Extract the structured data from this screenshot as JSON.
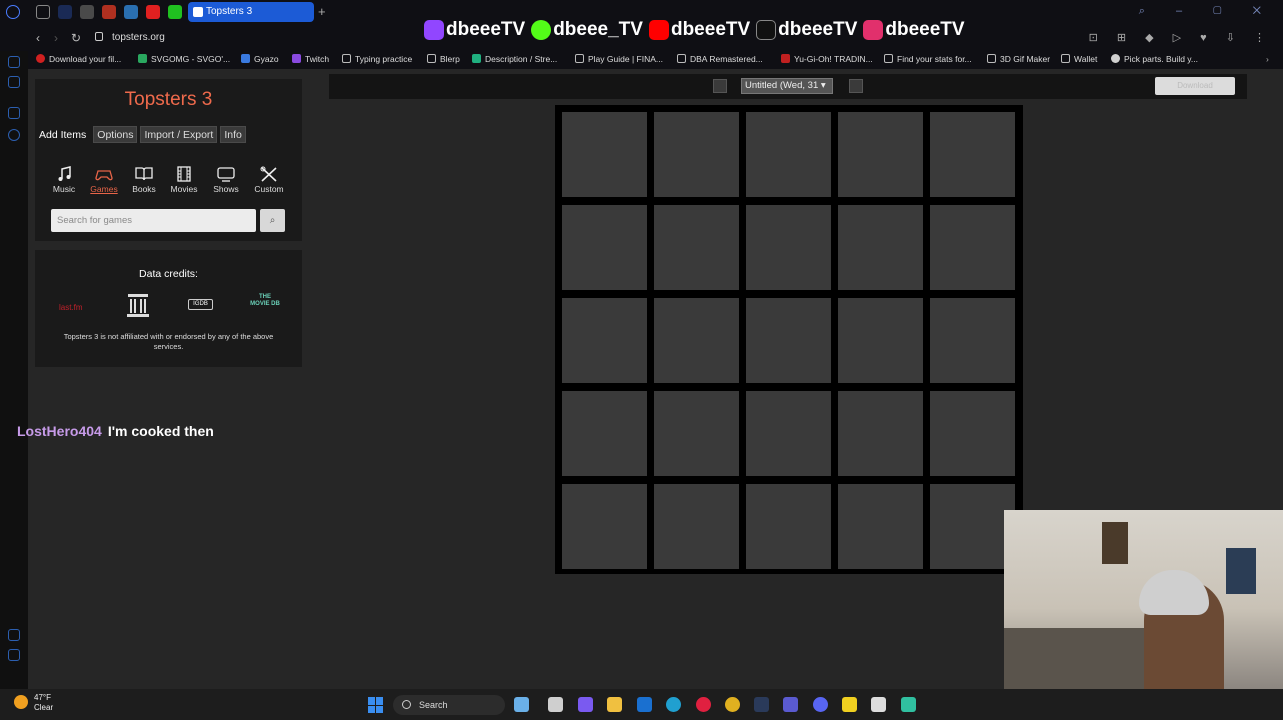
{
  "browser": {
    "active_tab_title": "Topsters 3",
    "url": "topsters.org",
    "bookmarks": [
      "Download your fil...",
      "SVGOMG - SVGO'...",
      "Gyazo",
      "Twitch",
      "Typing practice",
      "Blerp",
      "Description / Stre...",
      "Play Guide | FINA...",
      "DBA Remastered...",
      "Yu-Gi-Oh! TRADIN...",
      "Find your stats for...",
      "3D Gif Maker",
      "Wallet",
      "Pick parts. Build y..."
    ]
  },
  "overlay": {
    "socials": [
      "dbeeeTV",
      "dbeee_TV",
      "dbeeeTV",
      "dbeeeTV",
      "dbeeeTV"
    ],
    "chat_user": "LostHero404",
    "chat_message": "I'm cooked then"
  },
  "topsters": {
    "title": "Topsters 3",
    "tabs": [
      "Add Items",
      "Options",
      "Import / Export",
      "Info"
    ],
    "categories": [
      "Music",
      "Games",
      "Books",
      "Movies",
      "Shows",
      "Custom"
    ],
    "selected_category": "Games",
    "search_placeholder": "Search for games",
    "credits_title": "Data credits:",
    "credit_lastfm": "last.fm",
    "credit_igdb": "IGDB",
    "credit_tmdb": "THE MOVIE DB",
    "disclaimer": "Topsters 3 is not affiliated with or endorsed by any of the above services.",
    "chart_name": "Untitled (Wed, 31",
    "download_label": "Download",
    "grid_rows": 5,
    "grid_cols": 5
  },
  "taskbar": {
    "temperature": "47°F",
    "condition": "Clear",
    "search_label": "Search"
  },
  "colors": {
    "accent": "#ef6a4c",
    "chat_user": "#c79be9",
    "tab_active": "#1c5bd6"
  }
}
